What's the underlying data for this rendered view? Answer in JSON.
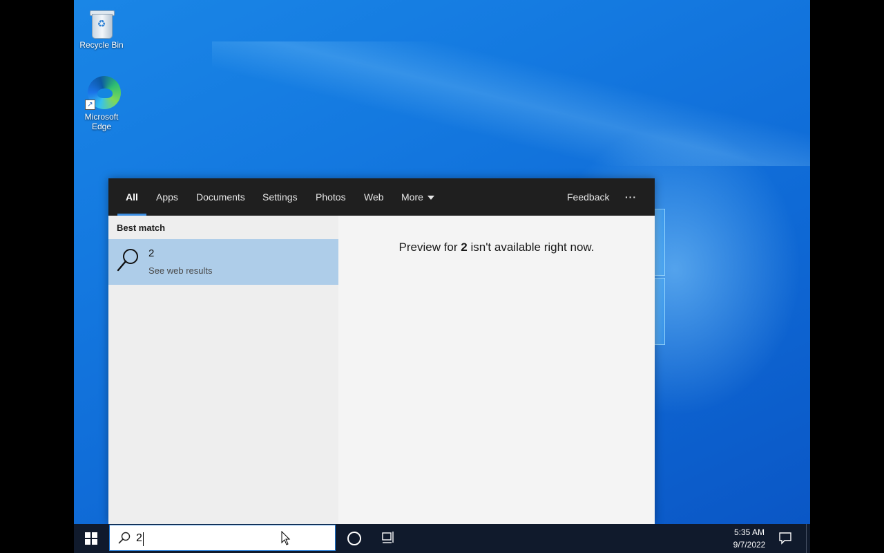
{
  "desktop": {
    "icons": [
      {
        "label": "Recycle Bin",
        "icon": "recycle-bin-icon"
      },
      {
        "label": "Microsoft Edge",
        "icon": "edge-icon"
      }
    ]
  },
  "search": {
    "tabs": [
      {
        "label": "All",
        "active": true
      },
      {
        "label": "Apps"
      },
      {
        "label": "Documents"
      },
      {
        "label": "Settings"
      },
      {
        "label": "Photos"
      },
      {
        "label": "Web"
      },
      {
        "label": "More"
      }
    ],
    "feedback_label": "Feedback",
    "more_options_label": "···",
    "best_match_heading": "Best match",
    "result": {
      "title": "2",
      "subtitle": "See web results",
      "icon": "search-icon"
    },
    "preview": {
      "prefix": "Preview for ",
      "term": "2",
      "suffix": " isn't available right now."
    },
    "query": "2"
  },
  "taskbar": {
    "time": "5:35 AM",
    "date": "9/7/2022"
  },
  "colors": {
    "accent": "#3c8de0",
    "selected_result": "#aecde9",
    "tabbar": "#1f1f1f",
    "taskbar": "#101a2c"
  }
}
